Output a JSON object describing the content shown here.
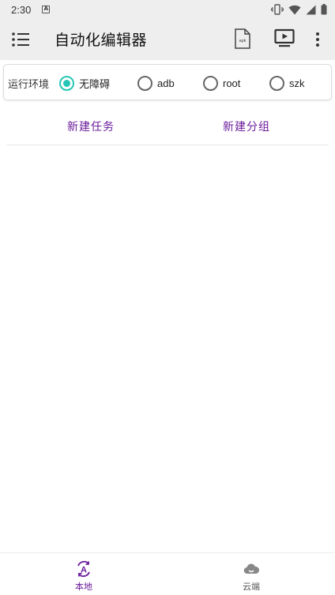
{
  "status_bar": {
    "time": "2:30",
    "icons": [
      "notification-a-icon",
      "vibrate-icon",
      "wifi-icon",
      "signal-icon",
      "battery-icon"
    ]
  },
  "app_bar": {
    "title": "自动化编辑器",
    "icons": [
      "menu-list-icon",
      "apk-file-icon",
      "cast-play-icon",
      "more-vert-icon"
    ]
  },
  "run_env": {
    "label": "运行环境",
    "options": [
      {
        "label": "无障碍",
        "checked": true
      },
      {
        "label": "adb",
        "checked": false
      },
      {
        "label": "root",
        "checked": false
      },
      {
        "label": "szk",
        "checked": false
      }
    ]
  },
  "actions": {
    "new_task": "新建任务",
    "new_group": "新建分组"
  },
  "bottom_nav": {
    "local": "本地",
    "cloud": "云端"
  },
  "colors": {
    "accent": "#6a1b9a",
    "radio_checked": "#26c6b6",
    "bar_bg": "#eeeeee"
  }
}
